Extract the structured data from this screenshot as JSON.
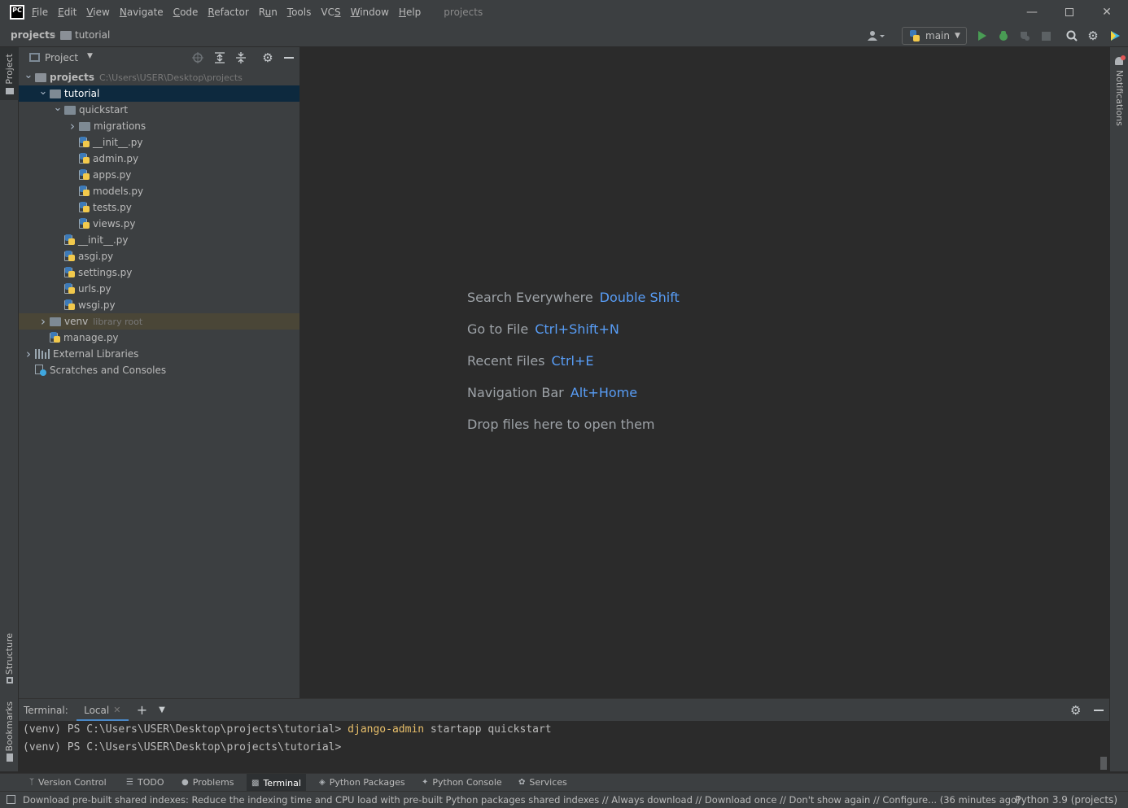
{
  "app": {
    "logo_text": "PC",
    "project_title": "projects"
  },
  "menu": [
    "File",
    "Edit",
    "View",
    "Navigate",
    "Code",
    "Refactor",
    "Run",
    "Tools",
    "VCS",
    "Window",
    "Help"
  ],
  "menu_mnemonics": [
    "F",
    "E",
    "V",
    "N",
    "C",
    "R",
    "u",
    "T",
    "S",
    "W",
    "H"
  ],
  "breadcrumb": {
    "root": "projects",
    "child": "tutorial"
  },
  "toolbar": {
    "run_config": "main"
  },
  "left_strip": {
    "project_label": "Project",
    "structure_label": "Structure",
    "bookmarks_label": "Bookmarks"
  },
  "right_strip": {
    "notifications_label": "Notifications"
  },
  "project_panel": {
    "title": "Project",
    "tree": [
      {
        "label": "projects",
        "hint": "C:\\Users\\USER\\Desktop\\projects",
        "type": "folder",
        "level": 0,
        "expanded": true,
        "bold": true
      },
      {
        "label": "tutorial",
        "hint": "",
        "type": "folder",
        "level": 1,
        "expanded": true,
        "selected": true
      },
      {
        "label": "quickstart",
        "hint": "",
        "type": "folder",
        "level": 2,
        "expanded": true
      },
      {
        "label": "migrations",
        "hint": "",
        "type": "folder",
        "level": 3,
        "expanded": false
      },
      {
        "label": "__init__.py",
        "hint": "",
        "type": "py",
        "level": 3
      },
      {
        "label": "admin.py",
        "hint": "",
        "type": "py",
        "level": 3
      },
      {
        "label": "apps.py",
        "hint": "",
        "type": "py",
        "level": 3
      },
      {
        "label": "models.py",
        "hint": "",
        "type": "py",
        "level": 3
      },
      {
        "label": "tests.py",
        "hint": "",
        "type": "py",
        "level": 3
      },
      {
        "label": "views.py",
        "hint": "",
        "type": "py",
        "level": 3
      },
      {
        "label": "__init__.py",
        "hint": "",
        "type": "py",
        "level": 2
      },
      {
        "label": "asgi.py",
        "hint": "",
        "type": "py",
        "level": 2
      },
      {
        "label": "settings.py",
        "hint": "",
        "type": "py",
        "level": 2
      },
      {
        "label": "urls.py",
        "hint": "",
        "type": "py",
        "level": 2
      },
      {
        "label": "wsgi.py",
        "hint": "",
        "type": "py",
        "level": 2
      },
      {
        "label": "venv",
        "hint": "library root",
        "type": "folder",
        "level": 1,
        "expanded": false,
        "venv": true
      },
      {
        "label": "manage.py",
        "hint": "",
        "type": "py",
        "level": 1
      },
      {
        "label": "External Libraries",
        "hint": "",
        "type": "lib",
        "level": 0,
        "expanded": false
      },
      {
        "label": "Scratches and Consoles",
        "hint": "",
        "type": "scratch",
        "level": 0
      }
    ]
  },
  "editor_tips": [
    {
      "label": "Search Everywhere",
      "key": "Double Shift"
    },
    {
      "label": "Go to File",
      "key": "Ctrl+Shift+N"
    },
    {
      "label": "Recent Files",
      "key": "Ctrl+E"
    },
    {
      "label": "Navigation Bar",
      "key": "Alt+Home"
    },
    {
      "label": "Drop files here to open them",
      "key": ""
    }
  ],
  "terminal": {
    "label": "Terminal:",
    "tab": "Local",
    "lines": [
      {
        "prompt": "(venv) PS C:\\Users\\USER\\Desktop\\projects\\tutorial> ",
        "cmd": "django-admin",
        "rest": " startapp quickstart"
      },
      {
        "prompt": "(venv) PS C:\\Users\\USER\\Desktop\\projects\\tutorial>",
        "cmd": "",
        "rest": ""
      }
    ]
  },
  "bottom_tabs": [
    {
      "label": "Version Control",
      "icon": "branch-icon"
    },
    {
      "label": "TODO",
      "icon": "list-icon"
    },
    {
      "label": "Problems",
      "icon": "info-icon"
    },
    {
      "label": "Terminal",
      "icon": "terminal-icon",
      "active": true
    },
    {
      "label": "Python Packages",
      "icon": "layers-icon"
    },
    {
      "label": "Python Console",
      "icon": "python-icon"
    },
    {
      "label": "Services",
      "icon": "services-icon"
    }
  ],
  "status": {
    "message": "Download pre-built shared indexes: Reduce the indexing time and CPU load with pre-built Python packages shared indexes // Always download // Download once // Don't show again // Configure... (36 minutes ago)",
    "interpreter": "Python 3.9 (projects)"
  },
  "colors": {
    "accent": "#589df6",
    "selection": "#0d293e",
    "run": "#499c54",
    "command": "#e8bf6a"
  }
}
